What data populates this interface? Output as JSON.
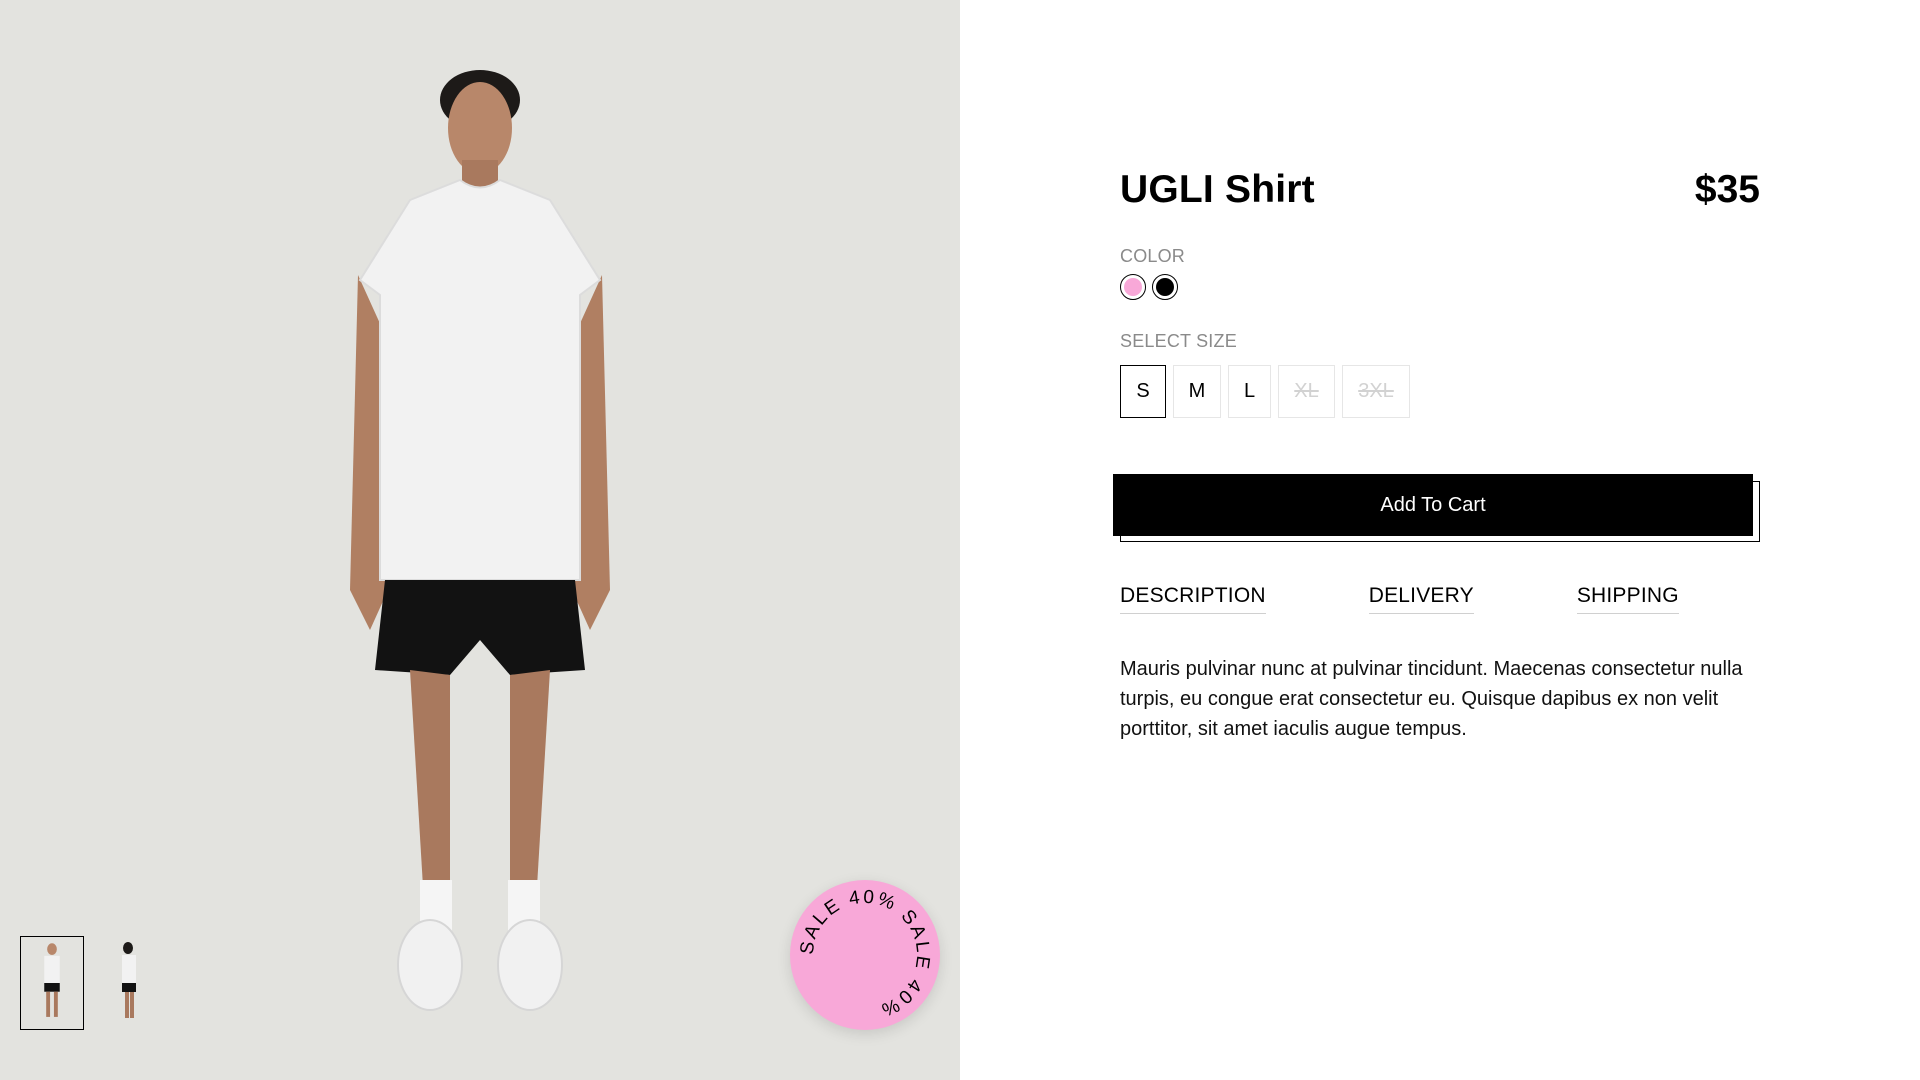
{
  "gallery": {
    "thumbnails": [
      {
        "alt": "front view"
      },
      {
        "alt": "side view"
      }
    ],
    "badge": {
      "text": "SALE 40% SALE 40% ",
      "color": "#f8a8d8"
    },
    "background": "#e3e3df"
  },
  "product": {
    "title": "UGLI Shirt",
    "price": "$35",
    "color_label": "COLOR",
    "colors": [
      {
        "name": "pink",
        "hex": "#f8a8d8",
        "selected": true
      },
      {
        "name": "black",
        "hex": "#000000",
        "selected": false
      }
    ],
    "size_label": "SELECT SIZE",
    "sizes": [
      {
        "label": "S",
        "selected": true,
        "available": true
      },
      {
        "label": "M",
        "selected": false,
        "available": true
      },
      {
        "label": "L",
        "selected": false,
        "available": true
      },
      {
        "label": "XL",
        "selected": false,
        "available": false
      },
      {
        "label": "3XL",
        "selected": false,
        "available": false
      }
    ],
    "cta": "Add To Cart",
    "tabs": [
      "DESCRIPTION",
      "DELIVERY",
      "SHIPPING"
    ],
    "description": "Mauris pulvinar nunc at pulvinar tincidunt. Maecenas consectetur nulla turpis, eu congue erat consectetur eu. Quisque dapibus ex non velit porttitor, sit amet iaculis augue tempus."
  }
}
